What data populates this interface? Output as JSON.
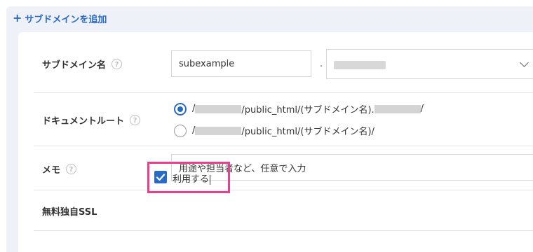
{
  "header": {
    "add_subdomain_label": "サブドメインを追加"
  },
  "form": {
    "subdomain": {
      "label": "サブドメイン名",
      "value": "subexample",
      "separator": "."
    },
    "document_root": {
      "label": "ドキュメントルート",
      "options": [
        {
          "prefix": "/",
          "middle": "/public_html/(サブドメイン名).",
          "suffix": "/",
          "selected": true
        },
        {
          "prefix": "/",
          "middle": "/public_html/(サブドメイン名)/",
          "suffix": "",
          "selected": false
        }
      ]
    },
    "memo": {
      "label": "メモ",
      "placeholder": "用途や担当者など、任意で入力"
    },
    "ssl": {
      "label": "無料独自SSL",
      "checkbox_label": "利用する",
      "checked": true
    }
  },
  "colors": {
    "accent": "#2a6ac4",
    "highlight": "#e6408f",
    "panel_bg": "#eef2f8"
  },
  "icons": {
    "add": "plus-icon",
    "help": "question-circle-icon",
    "dropdown": "chevron-down-icon",
    "check": "check-icon"
  }
}
